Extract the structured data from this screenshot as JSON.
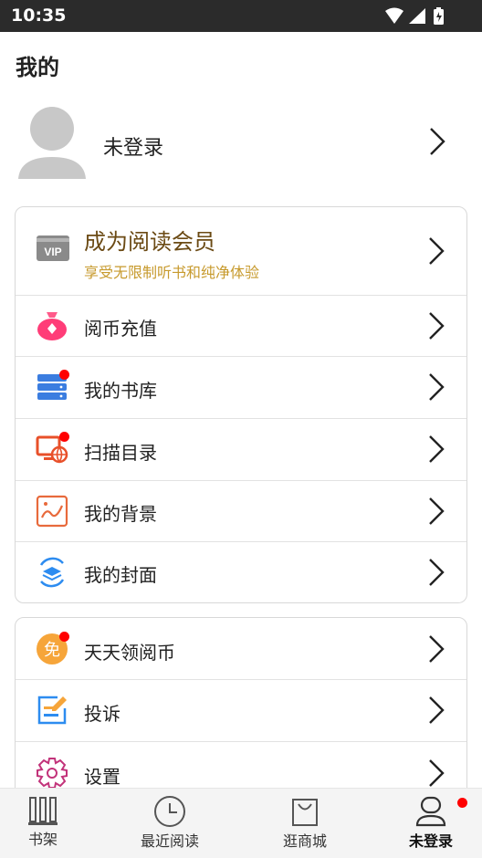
{
  "status_bar": {
    "time": "10:35"
  },
  "header": {
    "title": "我的"
  },
  "profile": {
    "name": "未登录"
  },
  "vip": {
    "title": "成为阅读会员",
    "subtitle": "享受无限制听书和纯净体验",
    "badge": "VIP"
  },
  "menu_card1": [
    {
      "label": "阅币充值",
      "icon": "money-bag-icon"
    },
    {
      "label": "我的书库",
      "icon": "library-icon",
      "dot": true
    },
    {
      "label": "扫描目录",
      "icon": "scan-folder-icon",
      "dot": true
    },
    {
      "label": "我的背景",
      "icon": "background-image-icon"
    },
    {
      "label": "我的封面",
      "icon": "cover-icon"
    }
  ],
  "menu_card2": [
    {
      "label": "天天领阅币",
      "icon": "free-coin-icon",
      "badge": "免",
      "dot": true
    },
    {
      "label": "投诉",
      "icon": "complaint-icon"
    },
    {
      "label": "设置",
      "icon": "settings-gear-icon"
    }
  ],
  "bottom_nav": [
    {
      "label": "书架",
      "icon": "bookshelf-icon"
    },
    {
      "label": "最近阅读",
      "icon": "clock-icon"
    },
    {
      "label": "逛商城",
      "icon": "shopping-bag-icon"
    },
    {
      "label": "未登录",
      "icon": "user-icon",
      "active": true,
      "dot": true
    }
  ],
  "colors": {
    "vip_title": "#6b4a14",
    "vip_sub": "#c79a2d",
    "notify_dot": "#ff0000"
  }
}
